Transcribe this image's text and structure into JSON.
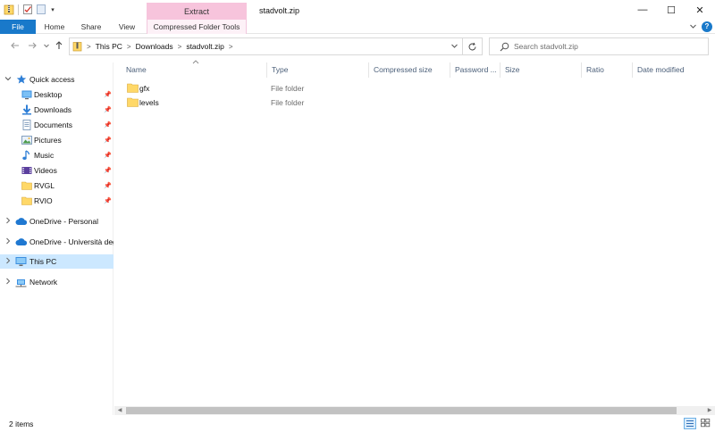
{
  "window": {
    "title": "stadvolt.zip",
    "contextual_tab_group": "Extract",
    "controls": {
      "minimize": "—",
      "maximize": "☐",
      "close": "✕"
    }
  },
  "ribbon": {
    "tabs": [
      {
        "label": "File"
      },
      {
        "label": "Home"
      },
      {
        "label": "Share"
      },
      {
        "label": "View"
      },
      {
        "label": "Compressed Folder Tools"
      }
    ],
    "toggle_icon": "chevron-down-icon",
    "help_label": "?"
  },
  "address_bar": {
    "breadcrumbs": [
      "This PC",
      "Downloads",
      "stadvolt.zip"
    ],
    "separator": ">"
  },
  "search": {
    "placeholder": "Search stadvolt.zip"
  },
  "nav_pane": {
    "quick_access_label": "Quick access",
    "pinned": [
      {
        "label": "Desktop",
        "icon": "desktop-icon"
      },
      {
        "label": "Downloads",
        "icon": "downloads-icon"
      },
      {
        "label": "Documents",
        "icon": "documents-icon"
      },
      {
        "label": "Pictures",
        "icon": "pictures-icon"
      },
      {
        "label": "Music",
        "icon": "music-icon"
      },
      {
        "label": "Videos",
        "icon": "videos-icon"
      },
      {
        "label": "RVGL",
        "icon": "folder-icon"
      },
      {
        "label": "RVIO",
        "icon": "folder-icon"
      }
    ],
    "onedrive_personal": "OneDrive - Personal",
    "onedrive_university": "OneDrive - Università deg",
    "this_pc": "This PC",
    "network": "Network"
  },
  "columns": [
    "Name",
    "Type",
    "Compressed size",
    "Password ...",
    "Size",
    "Ratio",
    "Date modified"
  ],
  "files": [
    {
      "name": "gfx",
      "type": "File folder"
    },
    {
      "name": "levels",
      "type": "File folder"
    }
  ],
  "status": {
    "item_count": "2 items"
  },
  "colors": {
    "accent": "#1979ca",
    "contextual_tab": "#f7c4dc",
    "selected": "#cce8ff",
    "folder": "#ffd868"
  }
}
